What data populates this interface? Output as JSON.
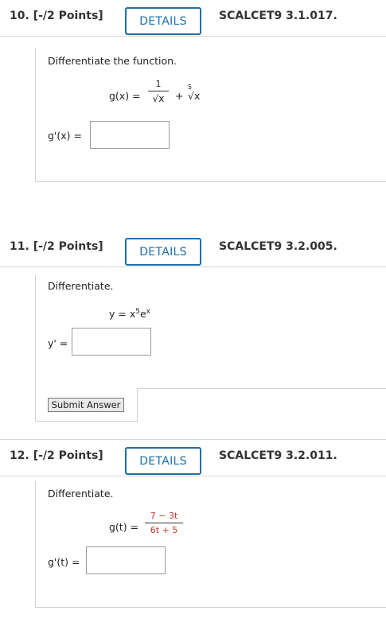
{
  "q10": {
    "number": "10.",
    "points": "[-/2 Points]",
    "details_label": "DETAILS",
    "code": "SCALCET9 3.1.017.",
    "prompt": "Differentiate the function.",
    "func_lhs": "g(x) =",
    "frac_num": "1",
    "frac_den": "√x",
    "plus_term": "+",
    "root_index": "5",
    "root_body": "√x",
    "answer_label": "g'(x) ="
  },
  "q11": {
    "number": "11.",
    "points": "[-/2 Points]",
    "details_label": "DETAILS",
    "code": "SCALCET9 3.2.005.",
    "prompt": "Differentiate.",
    "expr_lhs": "y = x",
    "expr_exp1": "5",
    "expr_e": "e",
    "expr_exp2": "x",
    "answer_label": "y' =",
    "submit_label": "Submit Answer"
  },
  "q12": {
    "number": "12.",
    "points": "[-/2 Points]",
    "details_label": "DETAILS",
    "code": "SCALCET9 3.2.011.",
    "prompt": "Differentiate.",
    "func_lhs": "g(t) =",
    "frac_num": "7 − 3t",
    "frac_den": "6t + 5",
    "answer_label": "g'(t) ="
  },
  "colors": {
    "accent": "#1f6fa8",
    "red": "#c0392b"
  }
}
